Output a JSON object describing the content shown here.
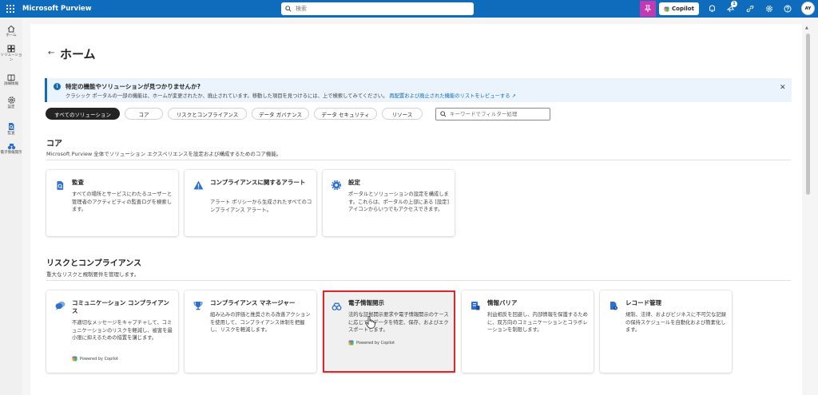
{
  "topbar": {
    "title": "Microsoft Purview",
    "search_placeholder": "検索",
    "copilot_label": "Copilot",
    "notification_count": "1",
    "avatar_initials": "AY",
    "brand_color": "#0f6cbd"
  },
  "leftnav": {
    "items": [
      {
        "label": "ホーム",
        "icon": "home-icon"
      },
      {
        "label": "ソリューション",
        "icon": "solutions-icon"
      },
      {
        "label": "詳細情報",
        "icon": "learn-icon"
      },
      {
        "label": "設定",
        "icon": "gear-icon"
      },
      {
        "label": "監査",
        "icon": "audit-icon"
      },
      {
        "label": "電子情報開示",
        "icon": "ediscovery-icon"
      }
    ]
  },
  "page": {
    "title": "ホーム"
  },
  "banner": {
    "title": "特定の機能やソリューションが見つかりませんか?",
    "text": "クラシック ポータルの一部の機能は、ホームが変更されたか、廃止されています。移動した項目を見つけるには、上で検索してみてください。",
    "link": "再配置および廃止された機能のリストをレビューする"
  },
  "filters": {
    "pills": [
      "すべてのソリューション",
      "コア",
      "リスクとコンプライアンス",
      "データ ガバナンス",
      "データ セキュリティ",
      "リソース"
    ],
    "active_index": 0,
    "search_placeholder": "キーワードでフィルター処理"
  },
  "sections": {
    "core": {
      "title": "コア",
      "subtitle": "Microsoft Purview 全体でソリューション エクスペリエンスを設定および構成するためのコア機能。",
      "cards": [
        {
          "title": "監査",
          "desc": "すべての場所とサービスにわたるユーザーと管理者のアクティビティの監査ログを検索します。"
        },
        {
          "title": "コンプライアンスに関するアラート",
          "desc": "アラート ポリシーから生成されたすべてのコンプライアンス アラート。"
        },
        {
          "title": "設定",
          "desc": "ポータルとソリューションの設定を構成します。これらは、ポータルの上部にある [設定] アイコンからいつでもアクセスできます。"
        }
      ]
    },
    "risk": {
      "title": "リスクとコンプライアンス",
      "subtitle": "重大なリスクと規制要件を管理します。",
      "cards": [
        {
          "title": "コミュニケーション コンプライアンス",
          "desc": "不適切なメッセージをキャプチャして、コミュニケーションのリスクを軽減し、被害を最小限に抑えるための措置を講じます。",
          "powered": "Powered by Copilot"
        },
        {
          "title": "コンプライアンス マネージャー",
          "desc": "組み込みの評価と推奨される改善アクションを使用して、コンプライアンス体制を把握し、リスクを軽減します。"
        },
        {
          "title": "電子情報開示",
          "desc": "法的な証拠開示要求や電子情報開示のケースに応じて、データを特定、保存、およびエクスポートします。",
          "powered": "Powered by Copilot"
        },
        {
          "title": "情報バリア",
          "desc": "利益相反を回避し、内部情報を保護するために、双方向のコミュニケーションとコラボレーションを制限します。"
        },
        {
          "title": "レコード管理",
          "desc": "規制、法律、およびビジネスに不可欠な記録の保持スケジュールを自動化および簡素化します。"
        }
      ]
    }
  }
}
